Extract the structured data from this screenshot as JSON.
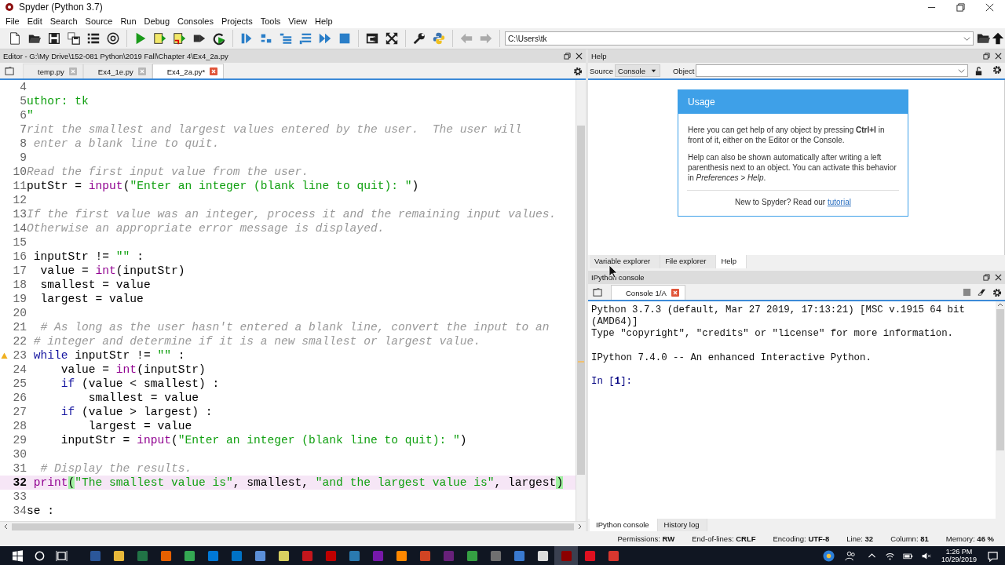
{
  "window": {
    "title": "Spyder (Python 3.7)"
  },
  "menu": [
    "File",
    "Edit",
    "Search",
    "Source",
    "Run",
    "Debug",
    "Consoles",
    "Projects",
    "Tools",
    "View",
    "Help"
  ],
  "path_field": {
    "value": "C:\\Users\\tk"
  },
  "editor": {
    "title": "Editor - G:\\My Drive\\152-081 Python\\2019 Fall\\Chapter 4\\Ex4_2a.py",
    "tabs": [
      {
        "label": "temp.py",
        "selected": false
      },
      {
        "label": "Ex4_1e.py",
        "selected": false
      },
      {
        "label": "Ex4_2a.py*",
        "selected": true
      }
    ],
    "lines": [
      {
        "number": "4",
        "current": false,
        "warning": false
      },
      {
        "number": "5",
        "current": false,
        "warning": false,
        "tokens": [
          {
            "kind": "docstring",
            "text": "uthor: tk"
          }
        ]
      },
      {
        "number": "6",
        "current": false,
        "warning": false,
        "tokens": [
          {
            "kind": "docstring",
            "text": "\""
          }
        ]
      },
      {
        "number": "7",
        "current": false,
        "warning": false,
        "tokens": [
          {
            "kind": "comment",
            "text": "rint the smallest and largest values entered by the user.  The user will"
          }
        ]
      },
      {
        "number": "8",
        "current": false,
        "warning": false,
        "tokens": [
          {
            "kind": "comment",
            "text": " enter a blank line to quit."
          }
        ]
      },
      {
        "number": "9",
        "current": false,
        "warning": false
      },
      {
        "number": "10",
        "current": false,
        "warning": false,
        "tokens": [
          {
            "kind": "comment",
            "text": "Read the first input value from the user."
          }
        ]
      },
      {
        "number": "11",
        "current": false,
        "warning": false,
        "tokens": [
          {
            "kind": "plain",
            "text": "putStr = "
          },
          {
            "kind": "builtin",
            "text": "input"
          },
          {
            "kind": "plain",
            "text": "("
          },
          {
            "kind": "string",
            "text": "\"Enter an integer (blank line to quit): \""
          },
          {
            "kind": "plain",
            "text": ")"
          }
        ]
      },
      {
        "number": "12",
        "current": false,
        "warning": false
      },
      {
        "number": "13",
        "current": false,
        "warning": false,
        "tokens": [
          {
            "kind": "comment",
            "text": "If the first value was an integer, process it and the remaining input values."
          }
        ]
      },
      {
        "number": "14",
        "current": false,
        "warning": false,
        "tokens": [
          {
            "kind": "comment",
            "text": "Otherwise an appropriate error message is displayed."
          }
        ]
      },
      {
        "number": "15",
        "current": false,
        "warning": false
      },
      {
        "number": "16",
        "current": false,
        "warning": false,
        "tokens": [
          {
            "kind": "plain",
            "text": " inputStr != "
          },
          {
            "kind": "string",
            "text": "\"\""
          },
          {
            "kind": "plain",
            "text": " :"
          }
        ]
      },
      {
        "number": "17",
        "current": false,
        "warning": false,
        "tokens": [
          {
            "kind": "plain",
            "text": "  value = "
          },
          {
            "kind": "builtin",
            "text": "int"
          },
          {
            "kind": "plain",
            "text": "(inputStr)"
          }
        ]
      },
      {
        "number": "18",
        "current": false,
        "warning": false,
        "tokens": [
          {
            "kind": "plain",
            "text": "  smallest = value"
          }
        ]
      },
      {
        "number": "19",
        "current": false,
        "warning": false,
        "tokens": [
          {
            "kind": "plain",
            "text": "  largest = value"
          }
        ]
      },
      {
        "number": "20",
        "current": false,
        "warning": false
      },
      {
        "number": "21",
        "current": false,
        "warning": false,
        "tokens": [
          {
            "kind": "comment",
            "text": "  # As long as the user hasn't entered a blank line, convert the input to an"
          }
        ]
      },
      {
        "number": "22",
        "current": false,
        "warning": false,
        "tokens": [
          {
            "kind": "comment",
            "text": " # integer and determine if it is a new smallest or largest value."
          }
        ]
      },
      {
        "number": "23",
        "current": false,
        "warning": true,
        "tokens": [
          {
            "kind": "keyword",
            "text": " while"
          },
          {
            "kind": "plain",
            "text": " inputStr != "
          },
          {
            "kind": "string",
            "text": "\"\""
          },
          {
            "kind": "plain",
            "text": " :"
          }
        ]
      },
      {
        "number": "24",
        "current": false,
        "warning": false,
        "tokens": [
          {
            "kind": "plain",
            "text": "     value = "
          },
          {
            "kind": "builtin",
            "text": "int"
          },
          {
            "kind": "plain",
            "text": "(inputStr)"
          }
        ]
      },
      {
        "number": "25",
        "current": false,
        "warning": false,
        "tokens": [
          {
            "kind": "keyword",
            "text": "     if"
          },
          {
            "kind": "plain",
            "text": " (value < smallest) :"
          }
        ]
      },
      {
        "number": "26",
        "current": false,
        "warning": false,
        "tokens": [
          {
            "kind": "plain",
            "text": "         smallest = value"
          }
        ]
      },
      {
        "number": "27",
        "current": false,
        "warning": false,
        "tokens": [
          {
            "kind": "keyword",
            "text": "     if"
          },
          {
            "kind": "plain",
            "text": " (value > largest) :"
          }
        ]
      },
      {
        "number": "28",
        "current": false,
        "warning": false,
        "tokens": [
          {
            "kind": "plain",
            "text": "         largest = value"
          }
        ]
      },
      {
        "number": "29",
        "current": false,
        "warning": false,
        "tokens": [
          {
            "kind": "plain",
            "text": "     inputStr = "
          },
          {
            "kind": "builtin",
            "text": "input"
          },
          {
            "kind": "plain",
            "text": "("
          },
          {
            "kind": "string",
            "text": "\"Enter an integer (blank line to quit): \""
          },
          {
            "kind": "plain",
            "text": ")"
          }
        ]
      },
      {
        "number": "30",
        "current": false,
        "warning": false
      },
      {
        "number": "31",
        "current": false,
        "warning": false,
        "tokens": [
          {
            "kind": "comment",
            "text": "  # Display the results."
          }
        ]
      },
      {
        "number": "32",
        "current": true,
        "warning": false,
        "tokens": [
          {
            "kind": "builtin",
            "text": " print"
          },
          {
            "kind": "bracket",
            "text": "("
          },
          {
            "kind": "string",
            "text": "\"The smallest value is\""
          },
          {
            "kind": "plain",
            "text": ", smallest, "
          },
          {
            "kind": "string",
            "text": "\"and the largest value is\""
          },
          {
            "kind": "plain",
            "text": ", largest"
          },
          {
            "kind": "bracket",
            "text": ")"
          }
        ]
      },
      {
        "number": "33",
        "current": false,
        "warning": false
      },
      {
        "number": "34",
        "current": false,
        "warning": false,
        "tokens": [
          {
            "kind": "plain",
            "text": "se :"
          }
        ]
      }
    ]
  },
  "help": {
    "title": "Help",
    "source_label": "Source",
    "source_value": "Console",
    "object_label": "Object",
    "card": {
      "title": "Usage",
      "paragraphs": [
        "Here you can get help of any object by pressing **Ctrl+I** in front of it, either on the Editor or the Console.",
        "Help can also be shown automatically after writing a left parenthesis next to an object. You can activate this behavior in *Preferences > Help*."
      ],
      "footer_text": "New to Spyder? Read our",
      "footer_link": "tutorial"
    },
    "tabs": [
      {
        "label": "Variable explorer",
        "selected": false
      },
      {
        "label": "File explorer",
        "selected": false
      },
      {
        "label": "Help",
        "selected": true
      }
    ]
  },
  "console": {
    "title": "IPython console",
    "tab": {
      "label": "Console 1/A"
    },
    "output": [
      {
        "text": "Python 3.7.3 (default, Mar 27 2019, 17:13:21) [MSC v.1915 64 bit",
        "blank_before": false
      },
      {
        "text": "(AMD64)]",
        "blank_before": false
      },
      {
        "text": "Type \"copyright\", \"credits\" or \"license\" for more information.",
        "blank_before": false
      },
      {
        "text": "IPython 7.4.0 -- An enhanced Interactive Python.",
        "blank_before": true
      }
    ],
    "prompt": "In [**1**]:",
    "tabs": [
      {
        "label": "IPython console",
        "selected": true
      },
      {
        "label": "History log",
        "selected": false
      }
    ]
  },
  "status_bar": [
    {
      "label": "Permissions:",
      "value": "RW"
    },
    {
      "label": "End-of-lines:",
      "value": "CRLF"
    },
    {
      "label": "Encoding:",
      "value": "UTF-8"
    },
    {
      "label": "Line:",
      "value": "32"
    },
    {
      "label": "Column:",
      "value": "81"
    },
    {
      "label": "Memory:",
      "value": "46 %"
    }
  ],
  "taskbar": {
    "apps": [
      {
        "color": "#2b579a",
        "selected": false
      },
      {
        "color": "#e8b83a",
        "selected": false
      },
      {
        "color": "#217346",
        "selected": false
      },
      {
        "color": "#e66000",
        "selected": false
      },
      {
        "color": "#34a853",
        "selected": false
      },
      {
        "color": "#0078d7",
        "selected": false
      },
      {
        "color": "#0072c6",
        "selected": false
      },
      {
        "color": "#5b8fd8",
        "selected": false
      },
      {
        "color": "#d8d060",
        "selected": false
      },
      {
        "color": "#c4161c",
        "selected": false
      },
      {
        "color": "#bf0000",
        "selected": false
      },
      {
        "color": "#2a7ab0",
        "selected": false
      },
      {
        "color": "#7719aa",
        "selected": false
      },
      {
        "color": "#ff8800",
        "selected": false
      },
      {
        "color": "#d04423",
        "selected": false
      },
      {
        "color": "#68217a",
        "selected": false
      },
      {
        "color": "#35a043",
        "selected": false
      },
      {
        "color": "#707070",
        "selected": false
      },
      {
        "color": "#3a7ad0",
        "selected": false
      },
      {
        "color": "#dddddd",
        "selected": false
      },
      {
        "color": "#8c0000",
        "selected": true
      },
      {
        "color": "#e01020",
        "selected": false
      },
      {
        "color": "#d9372f",
        "selected": false
      }
    ],
    "time": "1:26 PM",
    "date": "10/29/2019"
  }
}
